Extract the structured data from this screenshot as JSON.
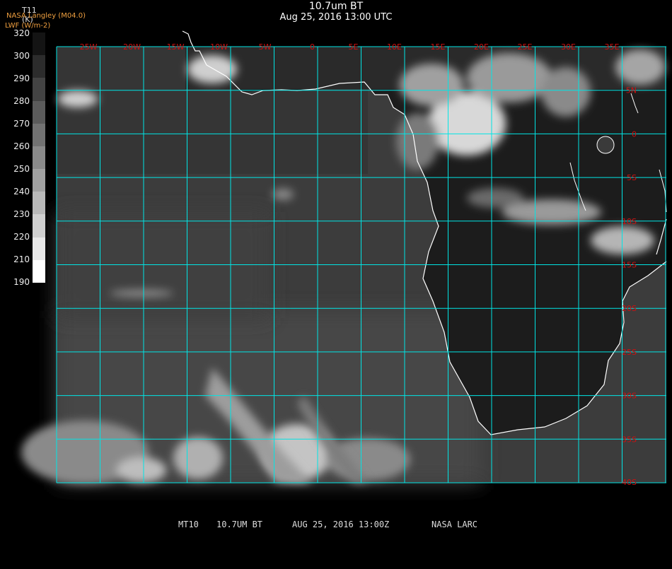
{
  "header": {
    "title": "10.7um BT",
    "subtitle": "Aug 25, 2016 13:00 UTC",
    "credit": "NASA Langley (M04.0)",
    "overlay_label": "LWF (W/m-2)",
    "variable": "T11",
    "units": "(K)"
  },
  "legend": {
    "labels": [
      "320",
      "300",
      "290",
      "280",
      "270",
      "260",
      "250",
      "240",
      "230",
      "220",
      "210",
      "190"
    ],
    "top_color": "#000000",
    "bottom_color": "#ffffff"
  },
  "map": {
    "lon_labels": [
      "25W",
      "20W",
      "15W",
      "10W",
      "5W",
      "0",
      "5E",
      "10E",
      "15E",
      "20E",
      "25E",
      "30E",
      "35E"
    ],
    "lat_labels": [
      "5N",
      "0",
      "5S",
      "10S",
      "15S",
      "20S",
      "25S",
      "30S",
      "35S",
      "40S"
    ],
    "grid_color": "#00e5e5",
    "label_color": "#d01010",
    "coast_color": "#ffffff"
  },
  "footer": {
    "sat": "MT10",
    "channel": "10.7UM BT",
    "datetime": "AUG 25, 2016 13:00Z",
    "org": "NASA LARC"
  }
}
